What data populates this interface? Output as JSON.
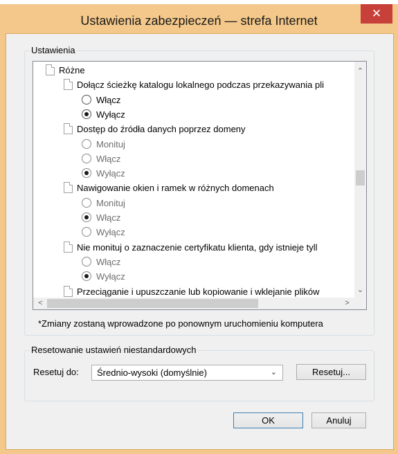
{
  "window": {
    "title": "Ustawienia zabezpieczeń — strefa Internet",
    "close_glyph": "✕"
  },
  "settings": {
    "group_label": "Ustawienia",
    "rows": [
      {
        "kind": "category",
        "text": "Różne"
      },
      {
        "kind": "setting",
        "text": "Dołącz ścieżkę katalogu lokalnego podczas przekazywania pli"
      },
      {
        "kind": "option",
        "text": "Włącz",
        "selected": false
      },
      {
        "kind": "option",
        "text": "Wyłącz",
        "selected": true
      },
      {
        "kind": "setting",
        "text": "Dostęp do źródła danych poprzez domeny"
      },
      {
        "kind": "option",
        "text": "Monituj",
        "selected": false,
        "dim": true
      },
      {
        "kind": "option",
        "text": "Włącz",
        "selected": false,
        "dim": true
      },
      {
        "kind": "option",
        "text": "Wyłącz",
        "selected": true,
        "dim": true
      },
      {
        "kind": "setting",
        "text": "Nawigowanie okien i ramek w różnych domenach"
      },
      {
        "kind": "option",
        "text": "Monituj",
        "selected": false,
        "dim": true
      },
      {
        "kind": "option",
        "text": "Włącz",
        "selected": true,
        "dim": true
      },
      {
        "kind": "option",
        "text": "Wyłącz",
        "selected": false,
        "dim": true
      },
      {
        "kind": "setting",
        "text": "Nie monituj o zaznaczenie certyfikatu klienta, gdy istnieje tyll"
      },
      {
        "kind": "option",
        "text": "Włącz",
        "selected": false,
        "dim": true
      },
      {
        "kind": "option",
        "text": "Wyłącz",
        "selected": true,
        "dim": true
      },
      {
        "kind": "setting",
        "text": "Przeciąganie i upuszczanie lub kopiowanie i wklejanie plików"
      }
    ],
    "scroll_up": "▲",
    "scroll_down": "▼",
    "scroll_left": "◄",
    "scroll_right": "►",
    "scroll_up_glyph": "⌃",
    "scroll_down_glyph": "⌄",
    "scroll_left_glyph": "<",
    "scroll_right_glyph": ">"
  },
  "restart_note": "*Zmiany zostaną wprowadzone po ponownym uruchomieniu komputera",
  "reset": {
    "group_label": "Resetowanie ustawień niestandardowych",
    "label": "Resetuj do:",
    "selected": "Średnio-wysoki (domyślnie)",
    "chevron": "⌄",
    "button": "Resetuj..."
  },
  "buttons": {
    "ok": "OK",
    "cancel": "Anuluj"
  }
}
